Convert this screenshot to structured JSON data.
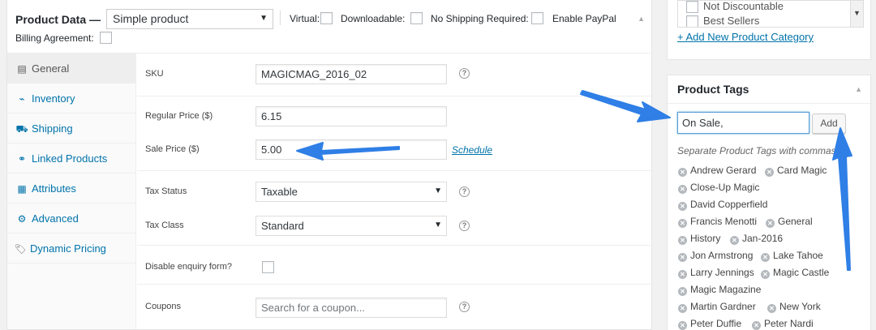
{
  "product_data": {
    "title": "Product Data —",
    "type_selected": "Simple product",
    "options": {
      "virtual": "Virtual:",
      "downloadable": "Downloadable:",
      "no_shipping": "No Shipping Required:",
      "paypal": "Enable PayPal",
      "billing": "Billing Agreement:"
    },
    "tabs": [
      {
        "label": "General",
        "icon": "general-icon"
      },
      {
        "label": "Inventory",
        "icon": "inventory-icon"
      },
      {
        "label": "Shipping",
        "icon": "shipping-icon"
      },
      {
        "label": "Linked Products",
        "icon": "link-icon"
      },
      {
        "label": "Attributes",
        "icon": "attributes-icon"
      },
      {
        "label": "Advanced",
        "icon": "gear-icon"
      },
      {
        "label": "Dynamic Pricing",
        "icon": "tag-icon"
      }
    ],
    "fields": {
      "sku_label": "SKU",
      "sku_value": "MAGICMAG_2016_02",
      "regular_price_label": "Regular Price ($)",
      "regular_price_value": "6.15",
      "sale_price_label": "Sale Price ($)",
      "sale_price_value": "5.00",
      "schedule_link": "Schedule",
      "tax_status_label": "Tax Status",
      "tax_status_value": "Taxable",
      "tax_class_label": "Tax Class",
      "tax_class_value": "Standard",
      "enquiry_label": "Disable enquiry form?",
      "coupons_label": "Coupons",
      "coupons_placeholder": "Search for a coupon..."
    }
  },
  "categories": {
    "items": [
      "Not Discountable",
      "Best Sellers"
    ],
    "add_link": "+ Add New Product Category"
  },
  "product_tags": {
    "title": "Product Tags",
    "input_value": "On Sale,",
    "add_button": "Add",
    "hint": "Separate Product Tags with commas",
    "tags": [
      "Andrew Gerard",
      "Card Magic",
      "Close-Up Magic",
      "David Copperfield",
      "Francis Menotti",
      "General",
      "History",
      "Jan-2016",
      "Jon Armstrong",
      "Lake Tahoe",
      "Larry Jennings",
      "Magic Castle",
      "Magic Magazine",
      "Martin Gardner",
      "New York",
      "Peter Duffie",
      "Peter Nardi"
    ]
  },
  "colors": {
    "link": "#0073aa",
    "annotation_arrow": "#2f7fe6"
  }
}
